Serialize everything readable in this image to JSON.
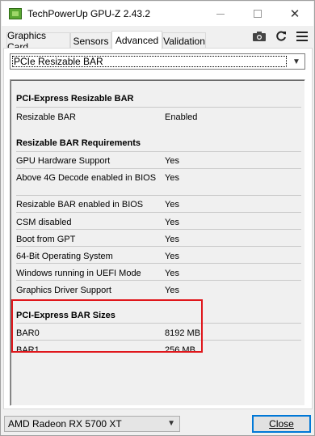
{
  "window": {
    "title": "TechPowerUp GPU-Z 2.43.2",
    "controls": {
      "minimize": "minimize-icon",
      "maximize": "maximize-icon",
      "close": "✕"
    }
  },
  "tabs": [
    {
      "label": "Graphics Card"
    },
    {
      "label": "Sensors"
    },
    {
      "label": "Advanced",
      "active": true
    },
    {
      "label": "Validation"
    }
  ],
  "toolbar": {
    "camera_icon": "camera-icon",
    "refresh_icon": "refresh-icon",
    "menu_icon": "hamburger-menu-icon"
  },
  "category_select": {
    "value": "PCIe Resizable BAR"
  },
  "sections": {
    "rebar": {
      "header": "PCI-Express Resizable BAR",
      "rows": [
        {
          "label": "Resizable BAR",
          "value": "Enabled"
        }
      ]
    },
    "requirements": {
      "header": "Resizable BAR Requirements",
      "rows": [
        {
          "label": "GPU Hardware Support",
          "value": "Yes"
        },
        {
          "label": "Above 4G Decode enabled in BIOS",
          "value": "Yes"
        },
        {
          "label": "Resizable BAR enabled in BIOS",
          "value": "Yes"
        },
        {
          "label": "CSM disabled",
          "value": "Yes"
        },
        {
          "label": "Boot from GPT",
          "value": "Yes"
        },
        {
          "label": "64-Bit Operating System",
          "value": "Yes"
        },
        {
          "label": "Windows running in UEFI Mode",
          "value": "Yes"
        },
        {
          "label": "Graphics Driver Support",
          "value": "Yes"
        }
      ]
    },
    "bar_sizes": {
      "header": "PCI-Express BAR Sizes",
      "rows": [
        {
          "label": "BAR0",
          "value": "8192 MB"
        },
        {
          "label": "BAR1",
          "value": "256 MB"
        }
      ]
    }
  },
  "gpu_select": {
    "value": "AMD Radeon RX 5700 XT"
  },
  "close_button": {
    "label": "Close"
  },
  "colors": {
    "highlight_border": "#e0161b",
    "focus_blue": "#0078d7"
  }
}
